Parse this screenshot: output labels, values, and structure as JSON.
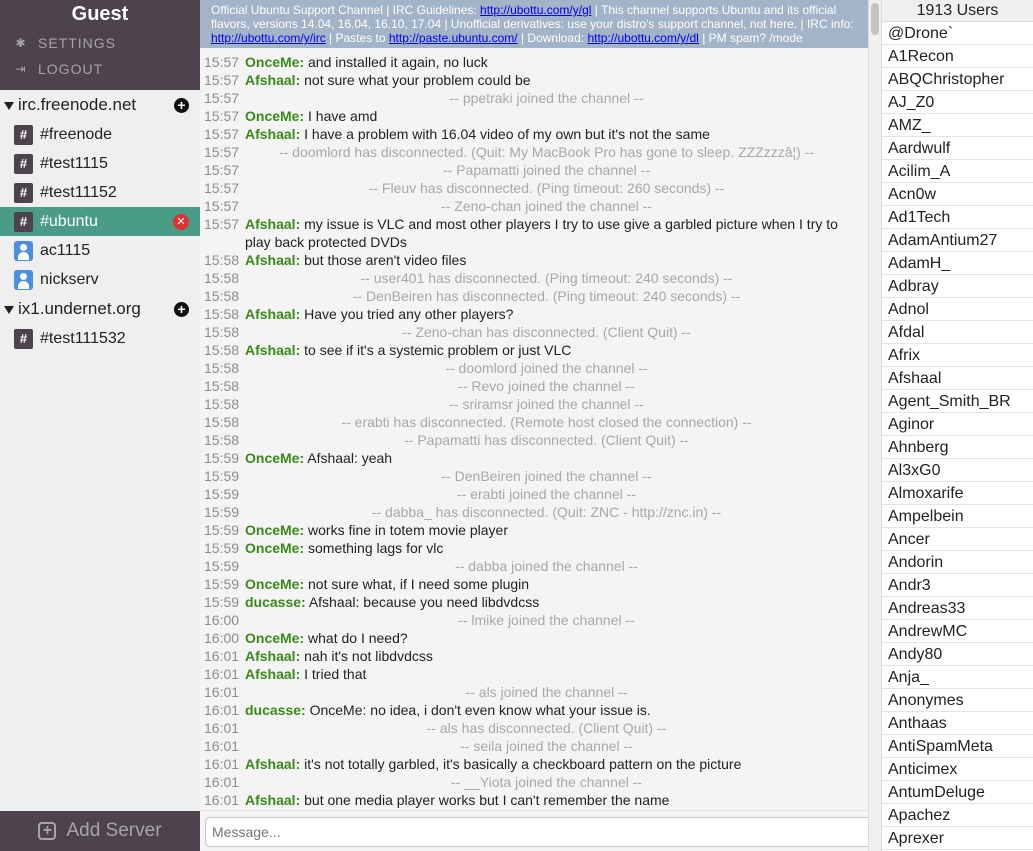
{
  "sidebar": {
    "username": "Guest",
    "settings_label": "SETTINGS",
    "logout_label": "LOGOUT",
    "servers": [
      {
        "name": "irc.freenode.net",
        "items": [
          {
            "type": "channel",
            "label": "#freenode"
          },
          {
            "type": "channel",
            "label": "#test1115"
          },
          {
            "type": "channel",
            "label": "#test11152"
          },
          {
            "type": "channel",
            "label": "#ubuntu",
            "active": true
          },
          {
            "type": "user",
            "label": "ac1115"
          },
          {
            "type": "user",
            "label": "nickserv"
          }
        ]
      },
      {
        "name": "ix1.undernet.org",
        "items": [
          {
            "type": "channel",
            "label": "#test111532"
          }
        ]
      }
    ],
    "add_server_label": "Add Server"
  },
  "topic": {
    "t1": "Official Ubuntu Support Channel | IRC Guidelines: ",
    "l1": "http://ubottu.com/y/gl",
    "t2": " | This channel supports Ubuntu and its official flavors, versions 14.04, 16.04, 16.10, 17.04 | Unofficial derivatives: use your distro's support channel, not here. | IRC info: ",
    "l2": "http://ubottu.com/y/irc",
    "t3": " | Pastes to ",
    "l3": "http://paste.ubuntu.com/",
    "t4": " | Download: ",
    "l4": "http://ubottu.com/y/dl",
    "t5": " | PM spam? /mode"
  },
  "messages": [
    {
      "time": "15:57",
      "nick": "OnceMe:",
      "text": "and installed it again, no luck"
    },
    {
      "time": "15:57",
      "nick": "Afshaal:",
      "text": "not sure what your problem could be"
    },
    {
      "time": "15:57",
      "event": "-- ppetraki joined the channel --"
    },
    {
      "time": "15:57",
      "nick": "OnceMe:",
      "text": "I have amd"
    },
    {
      "time": "15:57",
      "nick": "Afshaal:",
      "text": "I have a problem with 16.04 video of my own but it's not the same"
    },
    {
      "time": "15:57",
      "event": "-- doomlord has disconnected. (Quit: My MacBook Pro has gone to sleep. ZZZzzzâ¦) --"
    },
    {
      "time": "15:57",
      "event": "-- Papamatti joined the channel --"
    },
    {
      "time": "15:57",
      "event": "-- Fleuv has disconnected. (Ping timeout: 260 seconds) --"
    },
    {
      "time": "15:57",
      "event": "-- Zeno-chan joined the channel --"
    },
    {
      "time": "15:57",
      "nick": "Afshaal:",
      "text": "my issue is VLC and most other players I try to use give a garbled picture when I try to play back protected DVDs"
    },
    {
      "time": "15:58",
      "nick": "Afshaal:",
      "text": "but those aren't video files"
    },
    {
      "time": "15:58",
      "event": "-- user401 has disconnected. (Ping timeout: 240 seconds) --"
    },
    {
      "time": "15:58",
      "event": "-- DenBeiren has disconnected. (Ping timeout: 240 seconds) --"
    },
    {
      "time": "15:58",
      "nick": "Afshaal:",
      "text": "Have you tried any other players?"
    },
    {
      "time": "15:58",
      "event": "-- Zeno-chan has disconnected. (Client Quit) --"
    },
    {
      "time": "15:58",
      "nick": "Afshaal:",
      "text": "to see if it's a systemic problem or just VLC"
    },
    {
      "time": "15:58",
      "event": "-- doomlord joined the channel --"
    },
    {
      "time": "15:58",
      "event": "-- Revo joined the channel --"
    },
    {
      "time": "15:58",
      "event": "-- sriramsr joined the channel --"
    },
    {
      "time": "15:58",
      "event": "-- erabti has disconnected. (Remote host closed the connection) --"
    },
    {
      "time": "15:58",
      "event": "-- Papamatti has disconnected. (Client Quit) --"
    },
    {
      "time": "15:59",
      "nick": "OnceMe:",
      "text": "Afshaal: yeah"
    },
    {
      "time": "15:59",
      "event": "-- DenBeiren joined the channel --"
    },
    {
      "time": "15:59",
      "event": "-- erabti joined the channel --"
    },
    {
      "time": "15:59",
      "event": "-- dabba_ has disconnected. (Quit: ZNC - http://znc.in) --"
    },
    {
      "time": "15:59",
      "nick": "OnceMe:",
      "text": "works fine in totem movie player"
    },
    {
      "time": "15:59",
      "nick": "OnceMe:",
      "text": "something lags for vlc"
    },
    {
      "time": "15:59",
      "event": "-- dabba joined the channel --"
    },
    {
      "time": "15:59",
      "nick": "OnceMe:",
      "text": "not sure what, if I need some plugin"
    },
    {
      "time": "15:59",
      "nick": "ducasse:",
      "text": "Afshaal: because you need libdvdcss"
    },
    {
      "time": "16:00",
      "event": "-- lmike joined the channel --"
    },
    {
      "time": "16:00",
      "nick": "OnceMe:",
      "text": "what do I need?"
    },
    {
      "time": "16:01",
      "nick": "Afshaal:",
      "text": "nah it's not libdvdcss"
    },
    {
      "time": "16:01",
      "nick": "Afshaal:",
      "text": "I tried that"
    },
    {
      "time": "16:01",
      "event": "-- als joined the channel --"
    },
    {
      "time": "16:01",
      "nick": "ducasse:",
      "text": "OnceMe: no idea, i don't even know what your issue is."
    },
    {
      "time": "16:01",
      "event": "-- als has disconnected. (Client Quit) --"
    },
    {
      "time": "16:01",
      "event": "-- seila joined the channel --"
    },
    {
      "time": "16:01",
      "nick": "Afshaal:",
      "text": "it's not totally garbled, it's basically a checkboard pattern on the picture"
    },
    {
      "time": "16:01",
      "event": "-- __Yiota joined the channel --"
    },
    {
      "time": "16:01",
      "nick": "Afshaal:",
      "text": "but one media player works but I can't remember the name"
    }
  ],
  "input": {
    "placeholder": "Message..."
  },
  "userlist": {
    "count_label": "1913 Users",
    "users": [
      "@Drone`",
      "A1Recon",
      "ABQChristopher",
      "AJ_Z0",
      "AMZ_",
      "Aardwulf",
      "Acilim_A",
      "Acn0w",
      "Ad1Tech",
      "AdamAntium27",
      "AdamH_",
      "Adbray",
      "Adnol",
      "Afdal",
      "Afrix",
      "Afshaal",
      "Agent_Smith_BR",
      "Aginor",
      "Ahnberg",
      "Al3xG0",
      "Almoxarife",
      "Ampelbein",
      "Ancer",
      "Andorin",
      "Andr3",
      "Andreas33",
      "AndrewMC",
      "Andy80",
      "Anja_",
      "Anonymes",
      "Anthaas",
      "AntiSpamMeta",
      "Anticimex",
      "AntumDeluge",
      "Apachez",
      "Aprexer"
    ]
  },
  "colors": {
    "sidebar_dark": "#4d434d",
    "active_channel": "#4a9c86",
    "nick_green": "#3a8a1a",
    "topic_bg": "#a3b3c8"
  }
}
